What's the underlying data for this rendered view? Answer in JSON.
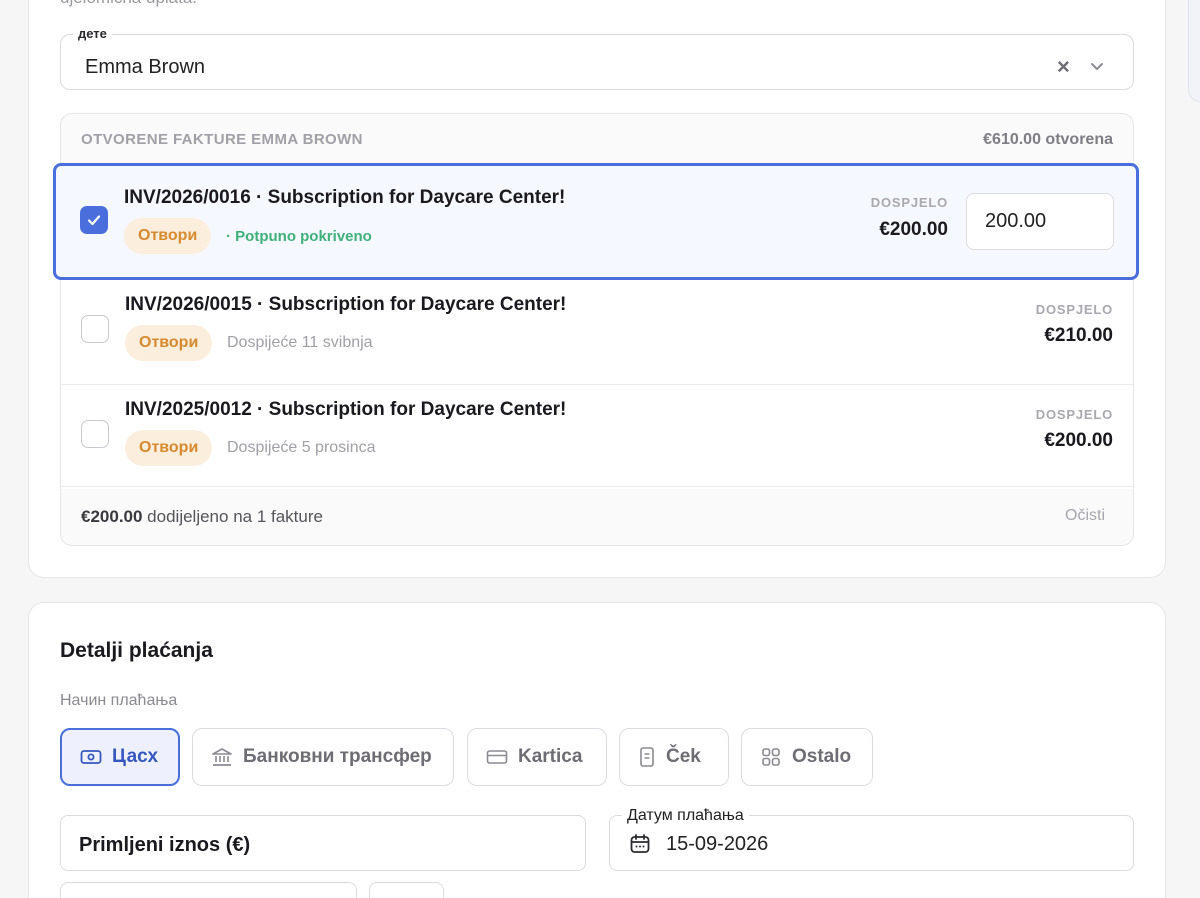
{
  "top_cut_text": "djelomična uplata.",
  "child_select": {
    "label": "дете",
    "value": "Emma Brown"
  },
  "invoices": {
    "header_title": "OTVORENE FAKTURE EMMA BROWN",
    "open_total": "€610.00 otvorena",
    "due_label": "DOSPJELO",
    "rows": [
      {
        "name": "INV/2026/0016 · Subscription for Daycare Center!",
        "badge": "Отвори",
        "note": "· Potpuno pokriveno",
        "due_amount": "€200.00",
        "allocated": "200.00",
        "checked": true
      },
      {
        "name": "INV/2026/0015 · Subscription for Daycare Center!",
        "badge": "Отвори",
        "note": "Dospijeće 11 svibnja",
        "due_amount": "€210.00",
        "checked": false
      },
      {
        "name": "INV/2025/0012 · Subscription for Daycare Center!",
        "badge": "Отвори",
        "note": "Dospijeće 5 prosinca",
        "due_amount": "€200.00",
        "checked": false
      }
    ],
    "footer_amount": "€200.00",
    "footer_text": " dodijeljeno na 1 fakture",
    "clear_label": "Očisti"
  },
  "payment": {
    "title": "Detalji plaćanja",
    "method_label": "Начин плаћања",
    "methods": [
      {
        "label": "Цасх",
        "icon": "cash-icon",
        "active": true
      },
      {
        "label": "Банковни трансфер",
        "icon": "bank-icon",
        "active": false
      },
      {
        "label": "Kartica",
        "icon": "card-icon",
        "active": false
      },
      {
        "label": "Ček",
        "icon": "check-document-icon",
        "active": false
      },
      {
        "label": "Ostalo",
        "icon": "grid-icon",
        "active": false
      }
    ],
    "amount_placeholder": "Primljeni iznos (€)",
    "date_label": "Датум плаћања",
    "date_value": "15-09-2026"
  },
  "colors": {
    "accent": "#4a6fdc",
    "badge_bg": "#fbeedd",
    "badge_text": "#d9892e",
    "success": "#3fb07a"
  }
}
